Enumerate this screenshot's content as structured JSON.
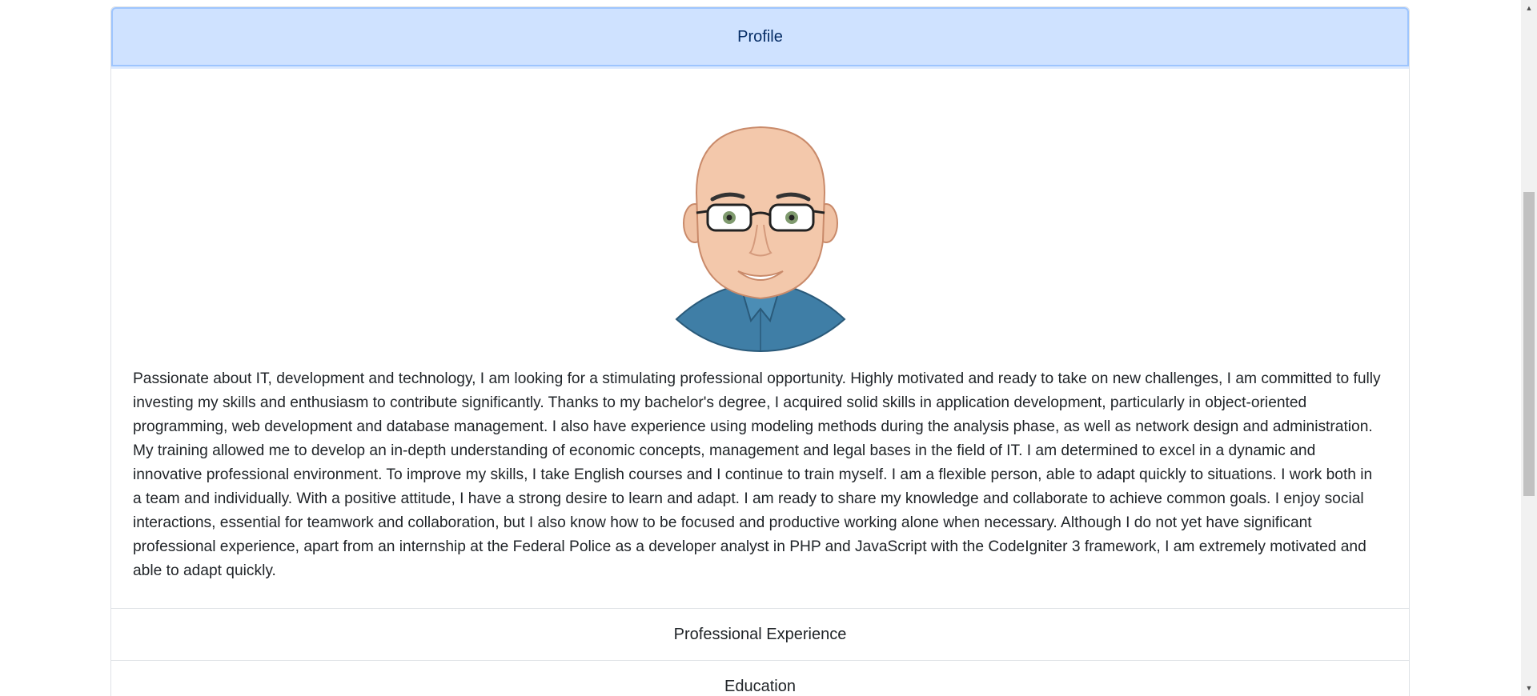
{
  "accordion": {
    "profile": {
      "title": "Profile",
      "avatar_icon": "cartoon-man-avatar",
      "text": "Passionate about IT, development and technology, I am looking for a stimulating professional opportunity. Highly motivated and ready to take on new challenges, I am committed to fully investing my skills and enthusiasm to contribute significantly. Thanks to my bachelor's degree, I acquired solid skills in application development, particularly in object-oriented programming, web development and database management. I also have experience using modeling methods during the analysis phase, as well as network design and administration. My training allowed me to develop an in-depth understanding of economic concepts, management and legal bases in the field of IT. I am determined to excel in a dynamic and innovative professional environment. To improve my skills, I take English courses and I continue to train myself. I am a flexible person, able to adapt quickly to situations. I work both in a team and individually. With a positive attitude, I have a strong desire to learn and adapt. I am ready to share my knowledge and collaborate to achieve common goals. I enjoy social interactions, essential for teamwork and collaboration, but I also know how to be focused and productive working alone when necessary. Although I do not yet have significant professional experience, apart from an internship at the Federal Police as a developer analyst in PHP and JavaScript with the CodeIgniter 3 framework, I am extremely motivated and able to adapt quickly."
    },
    "experience": {
      "title": "Professional Experience"
    },
    "education": {
      "title": "Education"
    }
  },
  "scrollbar": {
    "up_icon": "arrow-up-icon",
    "down_icon": "arrow-down-icon"
  },
  "colors": {
    "active_header_bg": "#cfe2ff",
    "active_header_text": "#052c65",
    "border": "#dfe2e6"
  }
}
